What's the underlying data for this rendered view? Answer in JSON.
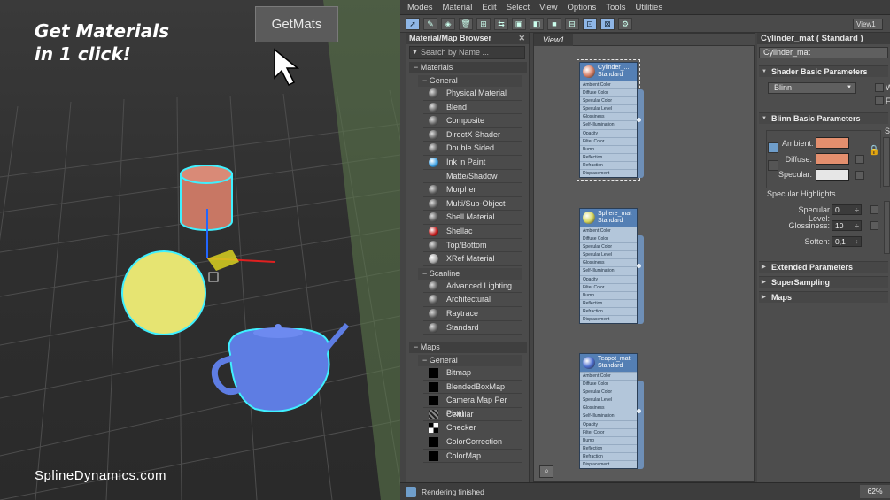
{
  "promo": {
    "line1": "Get Materials",
    "line2": "in 1 click!",
    "button": "GetMats",
    "site": "SplineDynamics.com"
  },
  "menu": [
    "Modes",
    "Material",
    "Edit",
    "Select",
    "View",
    "Options",
    "Tools",
    "Utilities"
  ],
  "view_dropdown": "View1",
  "browser": {
    "title": "Material/Map Browser",
    "search_placeholder": "Search by Name ...",
    "materials_label": "Materials",
    "general_label": "General",
    "general_items": [
      {
        "label": "Physical Material",
        "swatch": "#6e6e6e"
      },
      {
        "label": "Blend",
        "swatch": "#6e6e6e"
      },
      {
        "label": "Composite",
        "swatch": "#6e6e6e"
      },
      {
        "label": "DirectX Shader",
        "swatch": "#6e6e6e"
      },
      {
        "label": "Double Sided",
        "swatch": "#6e6e6e"
      },
      {
        "label": "Ink 'n Paint",
        "swatch": "#3fa2e4"
      },
      {
        "label": "Matte/Shadow",
        "swatch": "none"
      },
      {
        "label": "Morpher",
        "swatch": "#6e6e6e"
      },
      {
        "label": "Multi/Sub-Object",
        "swatch": "#6e6e6e"
      },
      {
        "label": "Shell Material",
        "swatch": "#6e6e6e"
      },
      {
        "label": "Shellac",
        "swatch": "#c01818"
      },
      {
        "label": "Top/Bottom",
        "swatch": "#6e6e6e"
      },
      {
        "label": "XRef Material",
        "swatch": "#aaaaaa"
      }
    ],
    "scanline_label": "Scanline",
    "scanline_items": [
      "Advanced Lighting...",
      "Architectural",
      "Raytrace",
      "Standard"
    ],
    "maps_label": "Maps",
    "maps_general_label": "General",
    "map_items": [
      "Bitmap",
      "BlendedBoxMap",
      "Camera Map Per Pixel",
      "Cellular",
      "Checker",
      "ColorCorrection",
      "ColorMap"
    ]
  },
  "view": {
    "tab": "View1",
    "nodes": [
      {
        "name": "Cylinder_...",
        "type": "Standard",
        "color": "#d9826a"
      },
      {
        "name": "Sphere_mat",
        "type": "Standard",
        "color": "#d8d860"
      },
      {
        "name": "Teapot_mat",
        "type": "Standard",
        "color": "#4e6fd0"
      }
    ],
    "slots": [
      "Ambient Color",
      "Diffuse Color",
      "Specular Color",
      "Specular Level",
      "Glossiness",
      "Self-Illumination",
      "Opacity",
      "Filter Color",
      "Bump",
      "Reflection",
      "Refraction",
      "Displacement"
    ]
  },
  "rollout": {
    "title": "Cylinder_mat  ( Standard )",
    "material_name": "Cylinder_mat",
    "shader_section": "Shader Basic Parameters",
    "shader_value": "Blinn",
    "shader_opt1": "W",
    "shader_opt2": "Fa",
    "blinn_section": "Blinn Basic Parameters",
    "ambient_label": "Ambient:",
    "diffuse_label": "Diffuse:",
    "specular_label": "Specular:",
    "ambient_color": "#e48f6e",
    "diffuse_color": "#e48f6e",
    "specular_color": "#e6e6e6",
    "lock_letter": "S",
    "highlights_label": "Specular Highlights",
    "spec_level_label": "Specular Level:",
    "spec_level": "0",
    "glossiness_label": "Glossiness:",
    "glossiness": "10",
    "soften_label": "Soften:",
    "soften": "0,1",
    "extended": "Extended Parameters",
    "supersampling": "SuperSampling",
    "maps": "Maps"
  },
  "status": {
    "text": "Rendering finished",
    "zoom": "62%"
  }
}
